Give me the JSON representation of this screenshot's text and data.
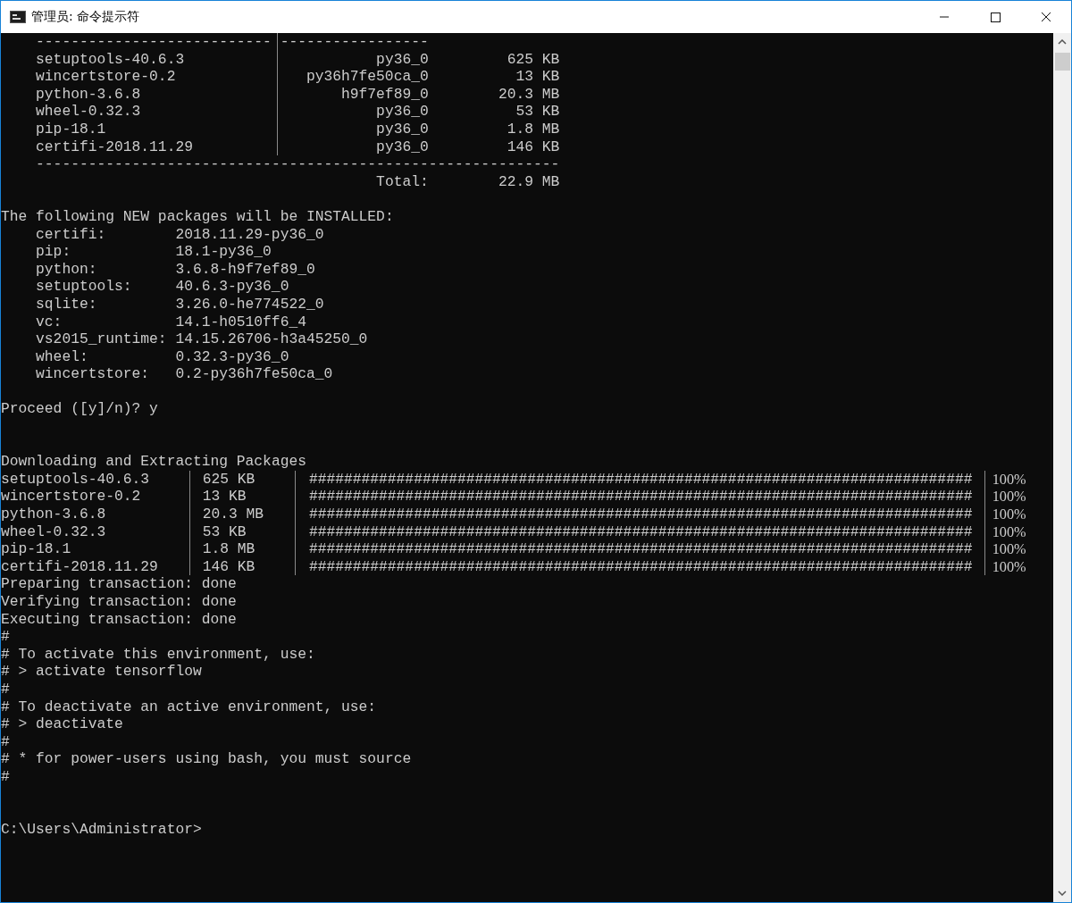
{
  "window": {
    "title": "管理员: 命令提示符"
  },
  "summary_table": {
    "rule_left": "---------------------------",
    "rule_right": "-----------------",
    "rows": [
      {
        "name": "setuptools-40.6.3",
        "build": "py36_0",
        "size": "625 KB"
      },
      {
        "name": "wincertstore-0.2",
        "build": "py36h7fe50ca_0",
        "size": "13 KB"
      },
      {
        "name": "python-3.6.8",
        "build": "h9f7ef89_0",
        "size": "20.3 MB"
      },
      {
        "name": "wheel-0.32.3",
        "build": "py36_0",
        "size": "53 KB"
      },
      {
        "name": "pip-18.1",
        "build": "py36_0",
        "size": "1.8 MB"
      },
      {
        "name": "certifi-2018.11.29",
        "build": "py36_0",
        "size": "146 KB"
      }
    ],
    "rule_bottom": "------------------------------------------------------------",
    "total_label": "Total:",
    "total_size": "22.9 MB"
  },
  "install_heading": "The following NEW packages will be INSTALLED:",
  "new_packages": [
    {
      "name": "certifi:",
      "version": "2018.11.29-py36_0"
    },
    {
      "name": "pip:",
      "version": "18.1-py36_0"
    },
    {
      "name": "python:",
      "version": "3.6.8-h9f7ef89_0"
    },
    {
      "name": "setuptools:",
      "version": "40.6.3-py36_0"
    },
    {
      "name": "sqlite:",
      "version": "3.26.0-he774522_0"
    },
    {
      "name": "vc:",
      "version": "14.1-h0510ff6_4"
    },
    {
      "name": "vs2015_runtime:",
      "version": "14.15.26706-h3a45250_0"
    },
    {
      "name": "wheel:",
      "version": "0.32.3-py36_0"
    },
    {
      "name": "wincertstore:",
      "version": "0.2-py36h7fe50ca_0"
    }
  ],
  "proceed_prompt": "Proceed ([y]/n)? y",
  "download_heading": "Downloading and Extracting Packages",
  "downloads": [
    {
      "name": "setuptools-40.6.3",
      "size": "625 KB",
      "bar": "############################################################################",
      "percent": "100%"
    },
    {
      "name": "wincertstore-0.2",
      "size": "13 KB",
      "bar": "############################################################################",
      "percent": "100%"
    },
    {
      "name": "python-3.6.8",
      "size": "20.3 MB",
      "bar": "############################################################################",
      "percent": "100%"
    },
    {
      "name": "wheel-0.32.3",
      "size": "53 KB",
      "bar": "############################################################################",
      "percent": "100%"
    },
    {
      "name": "pip-18.1",
      "size": "1.8 MB",
      "bar": "############################################################################",
      "percent": "100%"
    },
    {
      "name": "certifi-2018.11.29",
      "size": "146 KB",
      "bar": "############################################################################",
      "percent": "100%"
    }
  ],
  "transaction_steps": [
    "Preparing transaction: done",
    "Verifying transaction: done",
    "Executing transaction: done"
  ],
  "notes": [
    "#",
    "# To activate this environment, use:",
    "# > activate tensorflow",
    "#",
    "# To deactivate an active environment, use:",
    "# > deactivate",
    "#",
    "# * for power-users using bash, you must source",
    "#"
  ],
  "command_prompt": "C:\\Users\\Administrator>"
}
